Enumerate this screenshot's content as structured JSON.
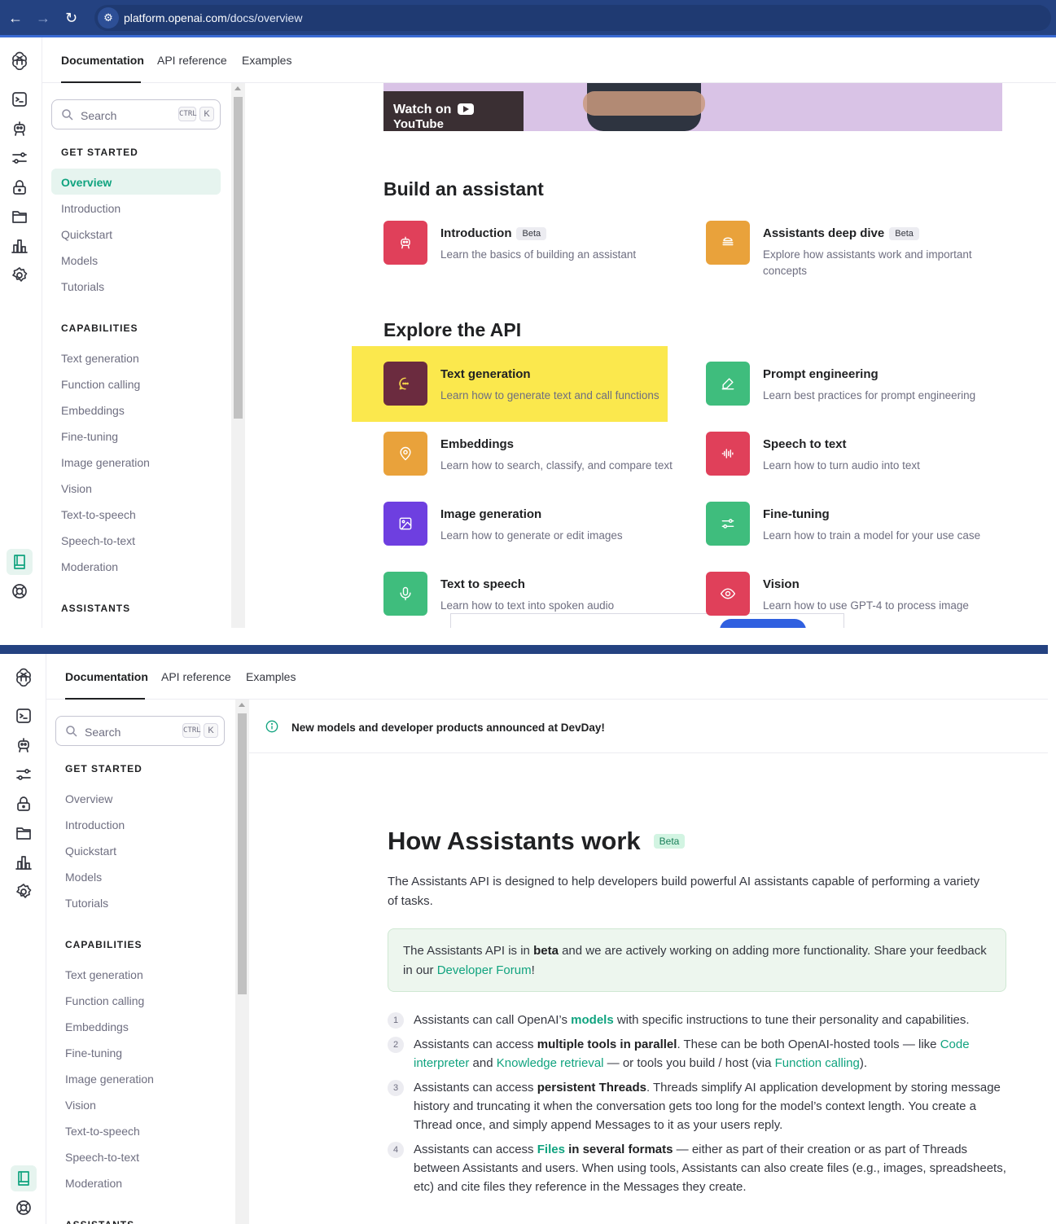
{
  "browser": {
    "url_host": "platform.openai.com",
    "url_path": "/docs/overview"
  },
  "top_nav": {
    "tabs": [
      "Documentation",
      "API reference",
      "Examples"
    ],
    "active_tab": "Documentation"
  },
  "sidebar": {
    "search_placeholder": "Search",
    "shortcut_modifier": "CTRL",
    "shortcut_key": "K",
    "sections": [
      {
        "title": "GET STARTED",
        "items": [
          "Overview",
          "Introduction",
          "Quickstart",
          "Models",
          "Tutorials"
        ]
      },
      {
        "title": "CAPABILITIES",
        "items": [
          "Text generation",
          "Function calling",
          "Embeddings",
          "Fine-tuning",
          "Image generation",
          "Vision",
          "Text-to-speech",
          "Speech-to-text",
          "Moderation"
        ]
      },
      {
        "title": "ASSISTANTS",
        "items": []
      }
    ],
    "active_item_top": "Overview"
  },
  "rail_icons": [
    "openai-logo-icon",
    "terminal-icon",
    "robot-icon",
    "sliders-icon",
    "lock-icon",
    "folder-icon",
    "bar-chart-icon",
    "gear-icon",
    "book-icon",
    "help-circle-icon"
  ],
  "overview": {
    "video_label": "Watch on",
    "video_brand": "YouTube",
    "build_heading": "Build an assistant",
    "build_cards": [
      {
        "title": "Introduction",
        "badge": "Beta",
        "desc": "Learn the basics of building an assistant",
        "color": "#e0405a",
        "icon": "robot-icon"
      },
      {
        "title": "Assistants deep dive",
        "badge": "Beta",
        "desc": "Explore how assistants work and important concepts",
        "color": "#e9a23b",
        "icon": "stack-icon"
      }
    ],
    "explore_heading": "Explore the API",
    "explore_cards": [
      {
        "title": "Text generation",
        "desc": "Learn how to generate text and call functions",
        "color": "#6b2b3f",
        "icon": "chat-bubble-icon",
        "highlighted": true
      },
      {
        "title": "Prompt engineering",
        "desc": "Learn best practices for prompt engineering",
        "color": "#3fbd7d",
        "icon": "edit-icon"
      },
      {
        "title": "Embeddings",
        "desc": "Learn how to search, classify, and compare text",
        "color": "#e9a23b",
        "icon": "map-pin-icon"
      },
      {
        "title": "Speech to text",
        "desc": "Learn how to turn audio into text",
        "color": "#e0405a",
        "icon": "waveform-icon"
      },
      {
        "title": "Image generation",
        "desc": "Learn how to generate or edit images",
        "color": "#6e3fe0",
        "icon": "image-icon"
      },
      {
        "title": "Fine-tuning",
        "desc": "Learn how to train a model for your use case",
        "color": "#3fbd7d",
        "icon": "sliders-icon"
      },
      {
        "title": "Text to speech",
        "desc": "Learn how to text into spoken audio",
        "color": "#3fbd7d",
        "icon": "microphone-icon"
      },
      {
        "title": "Vision",
        "desc": "Learn how to use GPT-4 to process image",
        "color": "#e0405a",
        "icon": "eye-icon"
      }
    ]
  },
  "assistants_page": {
    "notice": "New models and developer products announced at DevDay!",
    "title": "How Assistants work",
    "title_badge": "Beta",
    "lead": "The Assistants API is designed to help developers build powerful AI assistants capable of performing a variety of tasks.",
    "callout": {
      "pre": "The Assistants API is in ",
      "bold": "beta",
      "mid": " and we are actively working on adding more functionality. Share your feedback in our ",
      "link": "Developer Forum",
      "post": "!"
    },
    "steps": [
      {
        "n": "1",
        "parts": [
          [
            "t",
            "Assistants can call OpenAI’s "
          ],
          [
            "l",
            "models"
          ],
          [
            "t",
            " with specific instructions to tune their personality and capabilities."
          ]
        ]
      },
      {
        "n": "2",
        "parts": [
          [
            "t",
            "Assistants can access "
          ],
          [
            "b",
            "multiple tools in parallel"
          ],
          [
            "t",
            ". These can be both OpenAI-hosted tools — like "
          ],
          [
            "a",
            "Code interpreter"
          ],
          [
            "t",
            " and "
          ],
          [
            "a",
            "Knowledge retrieval"
          ],
          [
            "t",
            " — or tools you build / host (via "
          ],
          [
            "a",
            "Function calling"
          ],
          [
            "t",
            ")."
          ]
        ]
      },
      {
        "n": "3",
        "parts": [
          [
            "t",
            "Assistants can access "
          ],
          [
            "b",
            "persistent Threads"
          ],
          [
            "t",
            ". Threads simplify AI application development by storing message history and truncating it when the conversation gets too long for the model’s context length. You create a Thread once, and simply append Messages to it as your users reply."
          ]
        ]
      },
      {
        "n": "4",
        "parts": [
          [
            "t",
            "Assistants can access "
          ],
          [
            "l",
            "Files"
          ],
          [
            "b",
            " in several formats"
          ],
          [
            "t",
            " — either as part of their creation or as part of Threads between Assistants and users. When using tools, Assistants can also create files (e.g., images, spreadsheets, etc) and cite files they reference in the Messages they create."
          ]
        ]
      }
    ]
  },
  "colors": {
    "accent": "#10a37f",
    "browser_bar": "#244281",
    "highlight": "#fbe84d"
  }
}
